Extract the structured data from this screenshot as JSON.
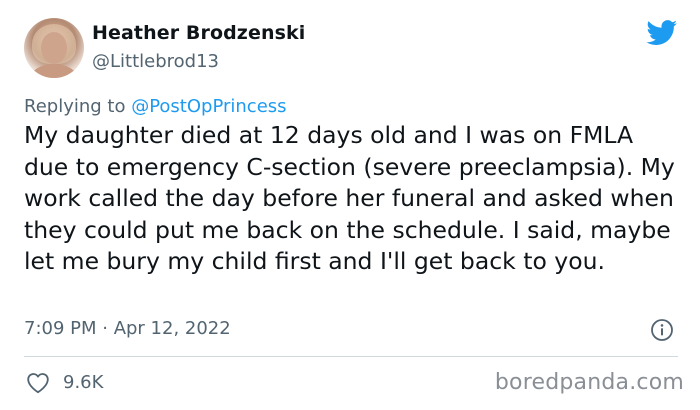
{
  "author": {
    "display_name": "Heather Brodzenski",
    "handle": "@Littlebrod13"
  },
  "reply": {
    "prefix": "Replying to ",
    "mention": "@PostOpPrincess"
  },
  "tweet": {
    "text": "My daughter died at 12 days old and I was on FMLA due to emergency C-section (severe preeclampsia). My work called the day before her funeral and asked when they could put me back on the schedule. I said, maybe let me bury my child first and I'll get back to you.",
    "timestamp": "7:09 PM · Apr 12, 2022",
    "like_count": "9.6K"
  },
  "icons": {
    "brand": "twitter-bird-icon",
    "info": "info-icon",
    "like": "heart-icon"
  },
  "watermark": {
    "text": "boredpanda.com"
  },
  "colors": {
    "twitter_blue": "#1d9bf0",
    "secondary_text": "#536471",
    "primary_text": "#0f1419",
    "divider": "#cfd9de",
    "watermark": "#8a8f96"
  }
}
